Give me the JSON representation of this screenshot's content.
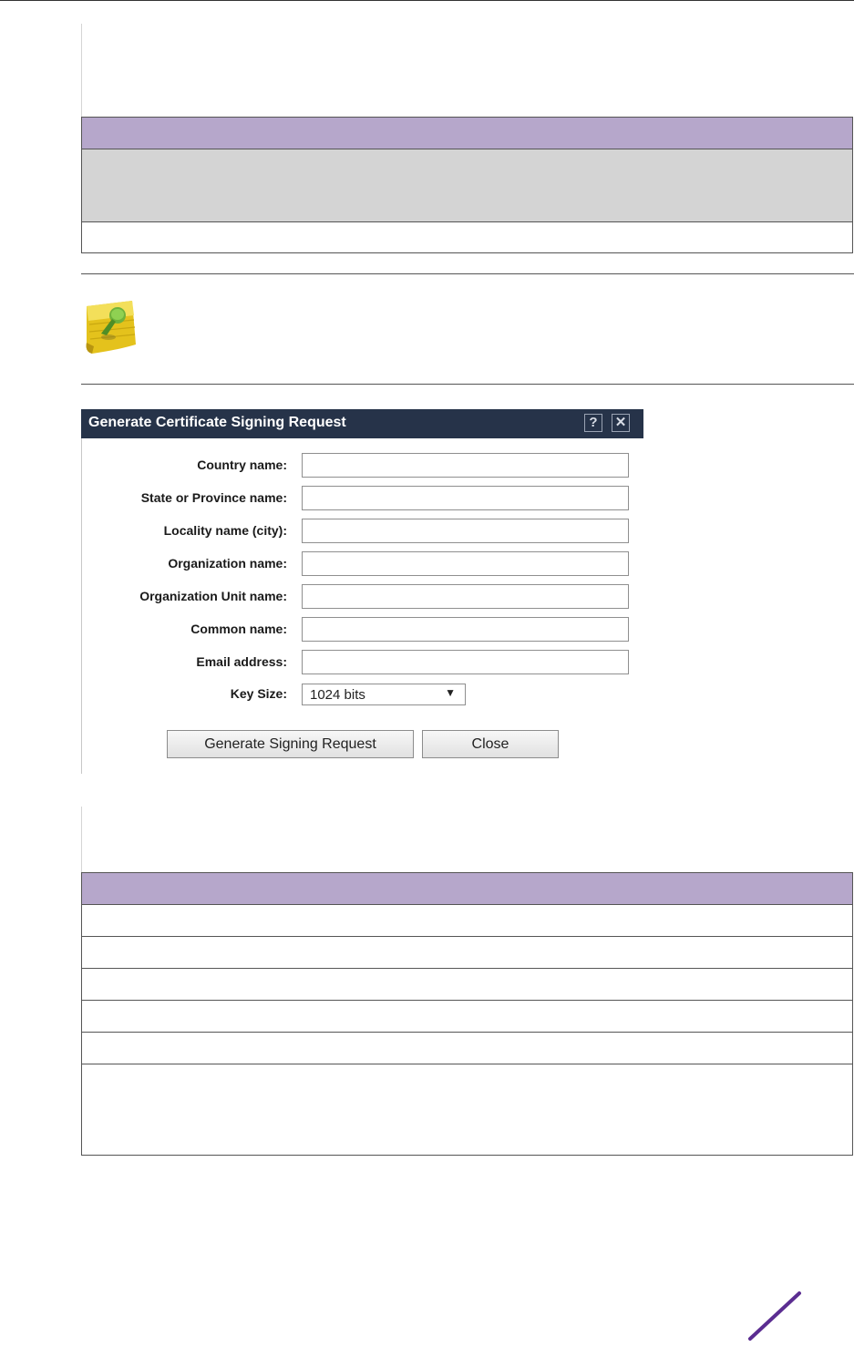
{
  "dialog": {
    "title": "Generate Certificate Signing Request",
    "help_glyph": "?",
    "close_glyph": "✕",
    "fields": [
      {
        "label": "Country name:",
        "value": ""
      },
      {
        "label": "State or Province name:",
        "value": ""
      },
      {
        "label": "Locality name (city):",
        "value": ""
      },
      {
        "label": "Organization name:",
        "value": ""
      },
      {
        "label": "Organization Unit name:",
        "value": ""
      },
      {
        "label": "Common name:",
        "value": ""
      },
      {
        "label": "Email address:",
        "value": ""
      }
    ],
    "key_size": {
      "label": "Key Size:",
      "selected": "1024 bits",
      "arrow": "▼"
    },
    "buttons": {
      "generate": "Generate Signing Request",
      "close": "Close"
    }
  },
  "colors": {
    "table_header": "#b6a7cb",
    "table_gray_row": "#d4d4d4",
    "dialog_titlebar": "#263349",
    "brand_accent": "#5b2d91"
  },
  "icons": {
    "note": "pushpin-note-icon",
    "logo": "brand-slash-logo"
  }
}
